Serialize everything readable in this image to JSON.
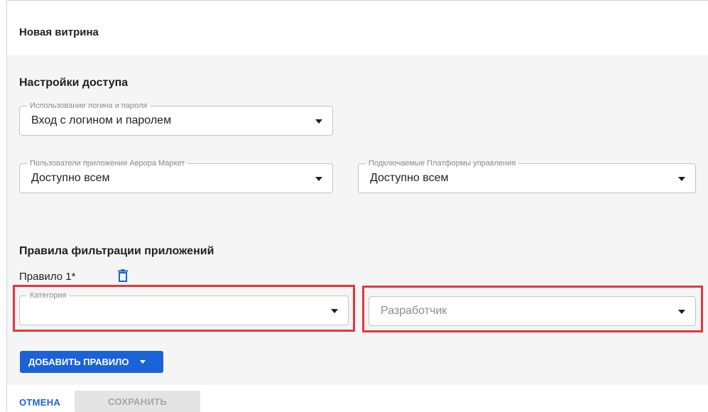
{
  "dialog": {
    "title": "Новая витрина"
  },
  "access": {
    "section_title": "Настройки доступа",
    "login_mode": {
      "legend": "Использование логина и пароля",
      "value": "Вход с логином и паролем"
    },
    "market_users": {
      "legend": "Пользователи приложения Аврора Маркет",
      "value": "Доступно всем"
    },
    "platforms": {
      "legend": "Подключаемые Платформы управления",
      "value": "Доступно всем"
    }
  },
  "filters": {
    "section_title": "Правила фильтрации приложений",
    "rule_label": "Правило 1*",
    "category": {
      "legend": "Категория",
      "value": ""
    },
    "developer": {
      "placeholder": "Разработчик"
    },
    "add_rule_label": "ДОБАВИТЬ ПРАВИЛО"
  },
  "footer": {
    "cancel_label": "ОТМЕНА",
    "save_label": "СОХРАНИТЬ"
  },
  "icons": {
    "trash": "trash-icon",
    "dropdown": "chevron-down-icon"
  },
  "colors": {
    "accent": "#1b62d6",
    "highlight": "#e5363d",
    "panel_bg": "#f5f5f6"
  }
}
